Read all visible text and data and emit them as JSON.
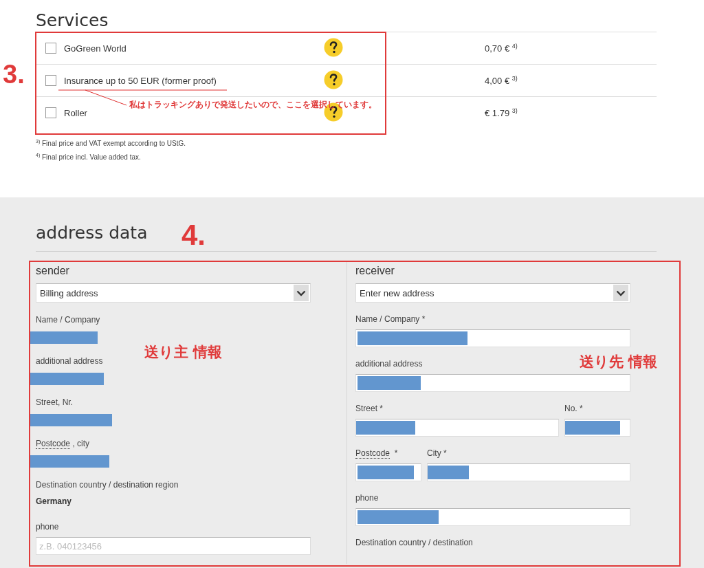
{
  "services": {
    "title": "Services",
    "rows": [
      {
        "label": "GoGreen World",
        "checked": false,
        "price": "0,70 € $^{4)}$"
      },
      {
        "label": "Insurance up to 50 EUR (former proof)",
        "checked": false,
        "price": "4,00 € $^{3)}$"
      },
      {
        "label": "Roller",
        "checked": false,
        "price": "€ 1.79 $^{3)}$"
      }
    ],
    "footnotes": [
      {
        "mark": "3)",
        "text": "Final price and VAT exempt according to UStG."
      },
      {
        "mark": "4)",
        "text": "Final price incl. Value added tax."
      }
    ]
  },
  "address": {
    "title": "address data",
    "sender": {
      "title": "sender",
      "select": "Billing address",
      "fields": [
        {
          "kind": "redacted",
          "label": "Name / Company"
        },
        {
          "kind": "redacted",
          "label": "additional address"
        },
        {
          "kind": "redacted",
          "label": "Street, Nr."
        },
        {
          "kind": "redacted",
          "abbr": "Postcode",
          "label": " , city"
        },
        {
          "kind": "value",
          "label": "Destination country / destination region",
          "value": "Germany"
        },
        {
          "kind": "input",
          "label": "phone",
          "placeholder": "z.B. 040123456"
        }
      ]
    },
    "receiver": {
      "title": "receiver",
      "select": "Enter new address",
      "rows": [
        [
          {
            "kind": "input",
            "label": "Name / Company *",
            "redacted": true
          }
        ],
        [
          {
            "kind": "input",
            "label": "additional address",
            "redacted": true
          }
        ],
        [
          {
            "kind": "input",
            "label": "Street *",
            "redacted": true
          },
          {
            "kind": "input",
            "label": "No. *",
            "redacted": true
          }
        ],
        [
          {
            "kind": "input",
            "abbr": "Postcode",
            "label": "  *",
            "redacted": true
          },
          {
            "kind": "input",
            "label": "City *",
            "redacted": true
          }
        ],
        [
          {
            "kind": "input",
            "label": "phone",
            "redacted": true
          }
        ],
        [
          {
            "kind": "label",
            "label": "Destination country / destination"
          }
        ]
      ]
    }
  },
  "annotations": [
    {
      "kind": "number",
      "text": "3."
    },
    {
      "kind": "note",
      "text": "私はトラッキングありで発送したいので、ここを選択しています。"
    },
    {
      "kind": "number",
      "text": "4."
    },
    {
      "kind": "tag",
      "text": "送り主 情報"
    },
    {
      "kind": "tag",
      "text": "送り先 情報"
    }
  ]
}
